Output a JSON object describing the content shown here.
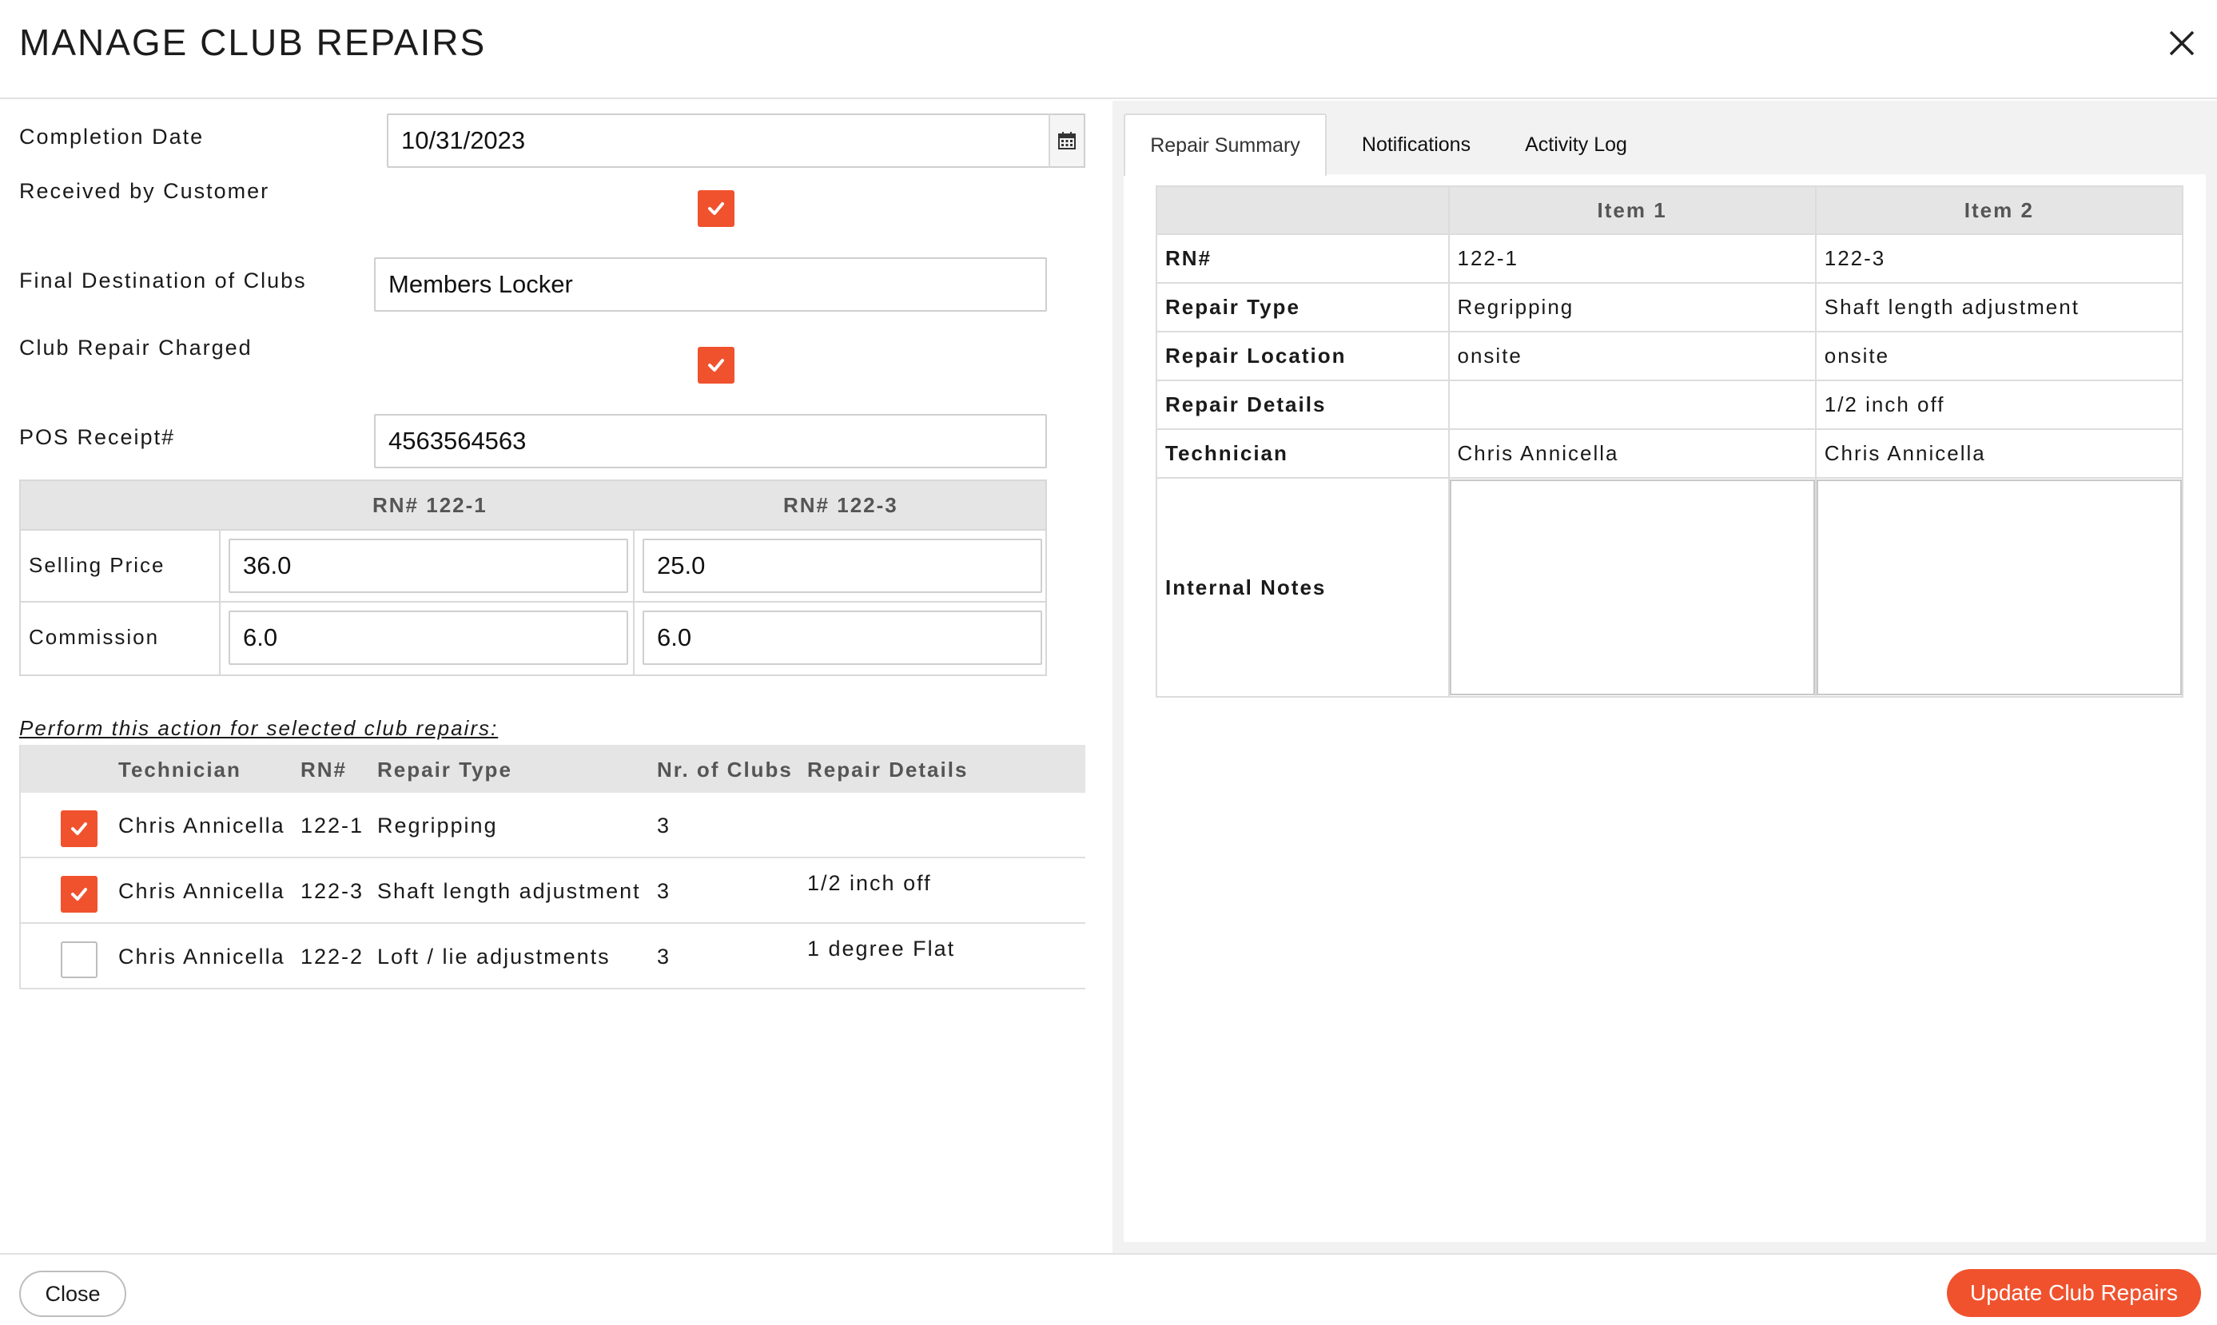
{
  "header": {
    "title": "MANAGE CLUB REPAIRS"
  },
  "form": {
    "completion_date_label": "Completion Date",
    "completion_date_value": "10/31/2023",
    "received_label": "Received by Customer",
    "received_checked": true,
    "destination_label": "Final Destination of Clubs",
    "destination_value": "Members Locker",
    "charged_label": "Club Repair Charged",
    "charged_checked": true,
    "pos_label": "POS Receipt#",
    "pos_value": "4563564563"
  },
  "pricing": {
    "col1": "RN# 122-1",
    "col2": "RN# 122-3",
    "selling_label": "Selling Price",
    "selling_1": "36.0",
    "selling_2": "25.0",
    "commission_label": "Commission",
    "commission_1": "6.0",
    "commission_2": "6.0"
  },
  "action_label": "Perform this action for selected club repairs:",
  "clubs": {
    "headers": {
      "technician": "Technician",
      "rn": "RN#",
      "repair_type": "Repair Type",
      "nr_clubs": "Nr. of Clubs",
      "repair_details": "Repair Details"
    },
    "rows": [
      {
        "checked": true,
        "technician": "Chris Annicella",
        "rn": "122-1",
        "repair_type": "Regripping",
        "nr_clubs": "3",
        "repair_details": ""
      },
      {
        "checked": true,
        "technician": "Chris Annicella",
        "rn": "122-3",
        "repair_type": "Shaft length adjustment",
        "nr_clubs": "3",
        "repair_details": "1/2 inch off"
      },
      {
        "checked": false,
        "technician": "Chris Annicella",
        "rn": "122-2",
        "repair_type": "Loft / lie adjustments",
        "nr_clubs": "3",
        "repair_details": "1 degree Flat"
      }
    ]
  },
  "tabs": [
    "Repair Summary",
    "Notifications",
    "Activity Log"
  ],
  "summary": {
    "col1": "Item 1",
    "col2": "Item 2",
    "rows": [
      {
        "label": "RN#",
        "v1": "122-1",
        "v2": "122-3"
      },
      {
        "label": "Repair Type",
        "v1": "Regripping",
        "v2": "Shaft length adjustment"
      },
      {
        "label": "Repair Location",
        "v1": "onsite",
        "v2": "onsite"
      },
      {
        "label": "Repair Details",
        "v1": "",
        "v2": "1/2 inch off"
      },
      {
        "label": "Technician",
        "v1": "Chris Annicella",
        "v2": "Chris Annicella"
      }
    ],
    "notes_label": "Internal Notes"
  },
  "footer": {
    "close_label": "Close",
    "update_label": "Update Club Repairs"
  },
  "colors": {
    "accent": "#f0522e"
  }
}
